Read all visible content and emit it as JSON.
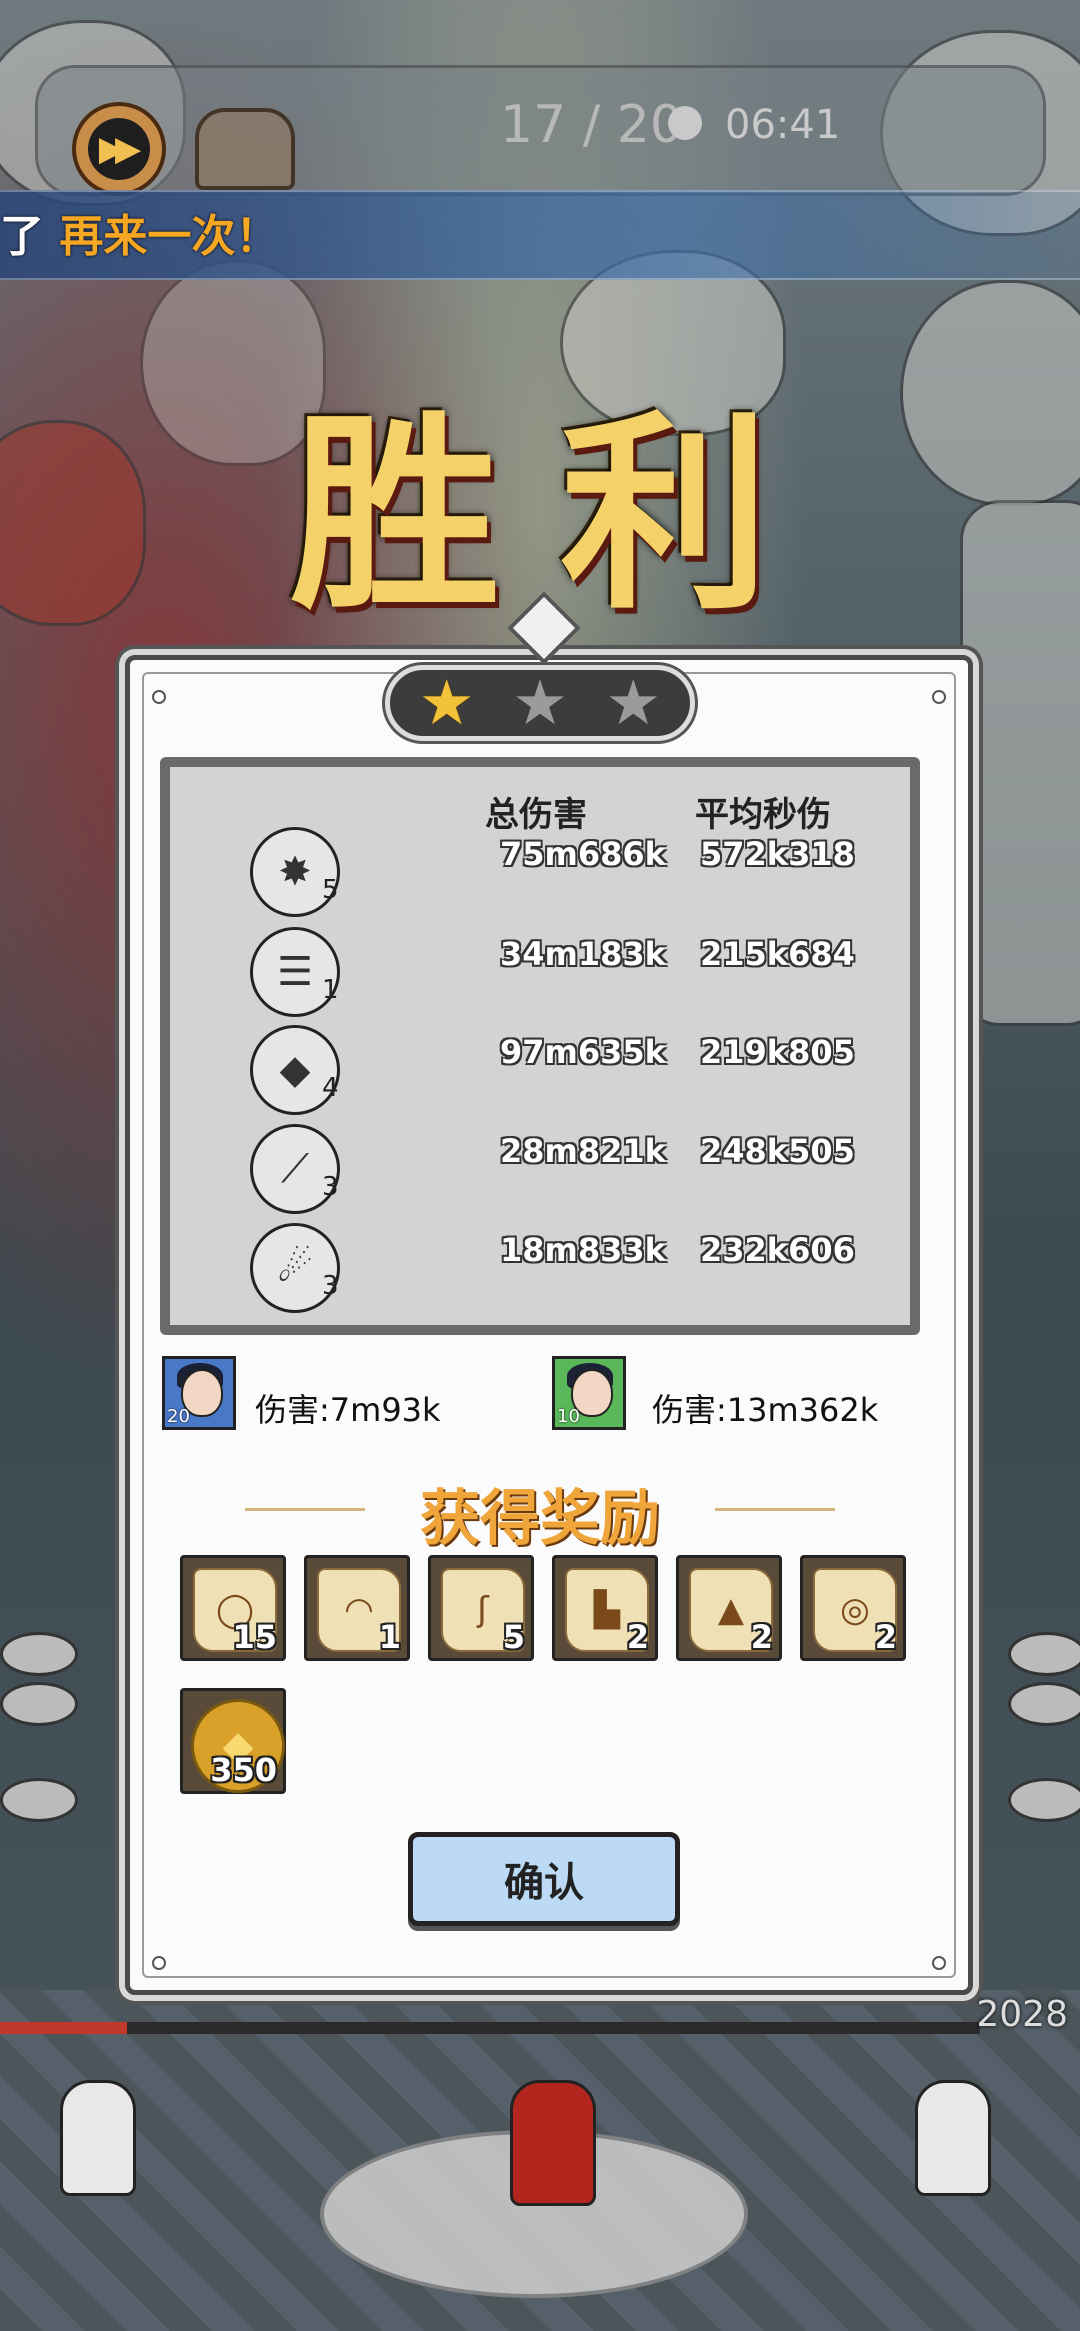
{
  "hud": {
    "wave": "17 / 20",
    "timer": "06:41",
    "fast_forward_icon": "fast-forward-icon",
    "chest_icon": "treasure-chest-icon"
  },
  "banner": {
    "prefix": "了",
    "text": "再来一次！"
  },
  "victory": {
    "title": "胜利"
  },
  "stars": {
    "earned": 1,
    "total": 3
  },
  "stats": {
    "header_total": "总伤害",
    "header_dps": "平均秒伤",
    "rows": [
      {
        "icon": "crystal-burst-icon",
        "level": "5",
        "total": "75m686k",
        "dps": "572k318"
      },
      {
        "icon": "whirlwind-icon",
        "level": "1",
        "total": "34m183k",
        "dps": "215k684"
      },
      {
        "icon": "shard-icon",
        "level": "4",
        "total": "97m635k",
        "dps": "219k805"
      },
      {
        "icon": "slash-icon",
        "level": "3",
        "total": "28m821k",
        "dps": "248k505"
      },
      {
        "icon": "comet-icon",
        "level": "3",
        "total": "18m833k",
        "dps": "232k606"
      }
    ]
  },
  "heroes": [
    {
      "level": "20",
      "damage": "伤害:7m93k",
      "frame_color": "#4a78c8"
    },
    {
      "level": "10",
      "damage": "伤害:13m362k",
      "frame_color": "#5ab85a"
    }
  ],
  "rewards": {
    "title": "获得奖励",
    "items": [
      {
        "icon": "scroll-necklace-icon",
        "count": "15"
      },
      {
        "icon": "scroll-hat-icon",
        "count": "1"
      },
      {
        "icon": "scroll-weapon-icon",
        "count": "5"
      },
      {
        "icon": "scroll-boots-icon",
        "count": "2"
      },
      {
        "icon": "scroll-cloak-icon",
        "count": "2"
      },
      {
        "icon": "scroll-ring-icon",
        "count": "2"
      }
    ],
    "coin": {
      "icon": "gold-coin-icon",
      "count": "350"
    }
  },
  "confirm_label": "确认",
  "boss_hp": {
    "value": "2028",
    "fill": 0.13
  }
}
